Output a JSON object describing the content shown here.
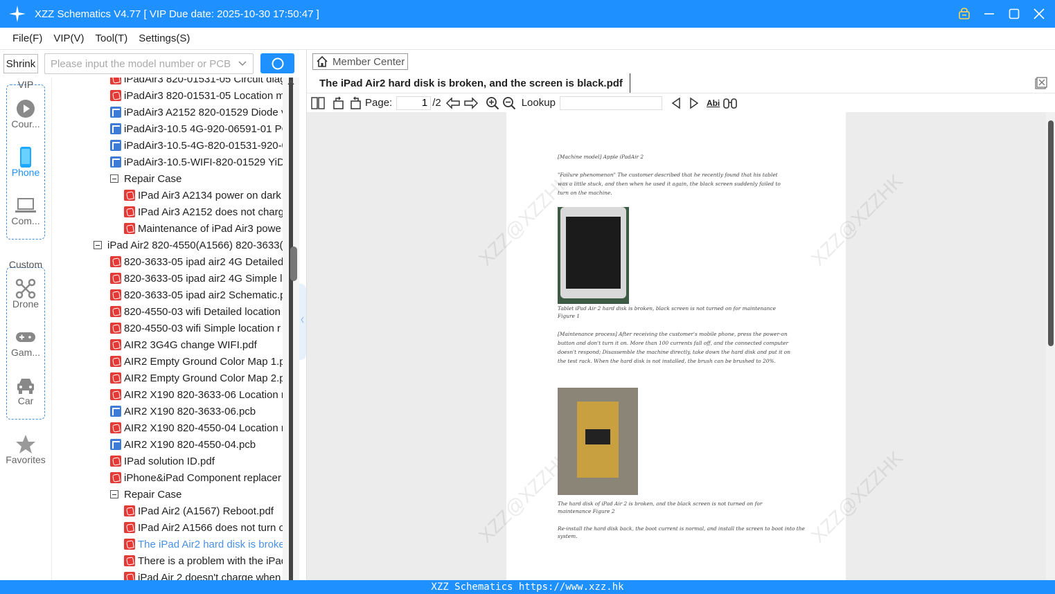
{
  "window": {
    "title": "XZZ Schematics V4.77 [ VIP Due date: 2025-10-30 17:50:47 ]"
  },
  "menu": [
    "File(F)",
    "VIP(V)",
    "Tool(T)",
    "Settings(S)"
  ],
  "search": {
    "shrink_label": "Shrink",
    "placeholder": "Please input the model number or PCB"
  },
  "rail": {
    "vip_label": "VIP",
    "custom_label": "Custom",
    "items": [
      "Cour...",
      "Phone",
      "Com...",
      "Drone",
      "Gam...",
      "Car",
      "Favorites"
    ]
  },
  "tree": [
    {
      "text": "iPadAir3 820-01531-05 Circuit diag",
      "kind": "pdf",
      "level": 1
    },
    {
      "text": "iPadAir3 820-01531-05 Location m",
      "kind": "pdf",
      "level": 1
    },
    {
      "text": "iPadAir3 A2152 820-01529 Diode v",
      "kind": "pcb",
      "level": 1
    },
    {
      "text": "iPadAir3-10.5 4G-920-06591-01 PC",
      "kind": "pcb",
      "level": 1
    },
    {
      "text": "iPadAir3-10.5-4G-820-01531-920-0",
      "kind": "pcb",
      "level": 1
    },
    {
      "text": "iPadAir3-10.5-WIFI-820-01529 YiDi",
      "kind": "pcb",
      "level": 1
    },
    {
      "text": "Repair Case",
      "kind": "folder",
      "level": 1
    },
    {
      "text": "IPad Air3 A2134 power on dark",
      "kind": "pdf",
      "level": 2
    },
    {
      "text": "IPad Air3 A2152 does not charg",
      "kind": "pdf",
      "level": 2
    },
    {
      "text": "Maintenance of iPad Air3 powe",
      "kind": "pdf",
      "level": 2
    },
    {
      "text": "iPad Air2 820-4550(A1566) 820-3633(",
      "kind": "folder",
      "level": 0
    },
    {
      "text": "820-3633-05 ipad air2 4G Detailed",
      "kind": "pdf",
      "level": 1
    },
    {
      "text": "820-3633-05 ipad air2 4G Simple lo",
      "kind": "pdf",
      "level": 1
    },
    {
      "text": "820-3633-05 ipad air2 Schematic.p",
      "kind": "pdf",
      "level": 1
    },
    {
      "text": "820-4550-03 wifi Detailed location",
      "kind": "pdf",
      "level": 1
    },
    {
      "text": "820-4550-03 wifi Simple location r",
      "kind": "pdf",
      "level": 1
    },
    {
      "text": "AIR2 3G4G change WIFI.pdf",
      "kind": "pdf",
      "level": 1
    },
    {
      "text": "AIR2 Empty Ground Color Map 1.p",
      "kind": "pdf",
      "level": 1
    },
    {
      "text": "AIR2 Empty Ground Color Map 2.p",
      "kind": "pdf",
      "level": 1
    },
    {
      "text": "AIR2 X190 820-3633-06 Location m",
      "kind": "pdf",
      "level": 1
    },
    {
      "text": "AIR2 X190 820-3633-06.pcb",
      "kind": "pcb",
      "level": 1
    },
    {
      "text": "AIR2 X190 820-4550-04 Location m",
      "kind": "pdf",
      "level": 1
    },
    {
      "text": "AIR2 X190 820-4550-04.pcb",
      "kind": "pcb",
      "level": 1
    },
    {
      "text": "IPad solution ID.pdf",
      "kind": "pdf",
      "level": 1
    },
    {
      "text": "iPhone&iPad Component replacer",
      "kind": "pdf",
      "level": 1
    },
    {
      "text": "Repair Case",
      "kind": "folder",
      "level": 1
    },
    {
      "text": "IPad Air2 (A1567) Reboot.pdf",
      "kind": "pdf",
      "level": 2
    },
    {
      "text": "IPad Air2 A1566 does not turn o",
      "kind": "pdf",
      "level": 2
    },
    {
      "text": "The iPad Air2 hard disk is broke",
      "kind": "pdf",
      "level": 2,
      "selected": true
    },
    {
      "text": "There is a problem with the iPad",
      "kind": "pdf",
      "level": 2
    },
    {
      "text": "iPad Air 2 doesn't charge when",
      "kind": "pdf",
      "level": 2
    }
  ],
  "right": {
    "member_center": "Member Center",
    "doc_title": "The iPad Air2 hard disk is broken, and the screen is black.pdf",
    "page_label": "Page:",
    "page_current": "1",
    "page_total": "/2",
    "lookup_label": "Lookup",
    "abi_label": "Abi"
  },
  "pdf_content": {
    "model": "[Machine model] Apple iPadAir 2",
    "failure": "\"Failure phenomenon\" The customer described that he recently found that his tablet was a little stuck, and then when he used it again, the black screen suddenly failed to turn on the machine.",
    "fig1": "Tablet iPad Air 2 hard disk is broken, black screen is not turned on for maintenance Figure 1",
    "process": "[Maintenance process] After receiving the customer's mobile phone, press the power-on button and don't turn it on. More than 100 currents fall off, and the connected computer doesn't respond; Disassemble the machine directly, take down the hard disk and put it on the test rack. When the hard disk is not installed, the brush can be brushed to 20%.",
    "fig2": "The hard disk of iPad Air 2 is broken, and the black screen is not turned on for maintenance Figure 2",
    "reinstall": "Re-install the hard disk back, the boot current is normal, and install the screen to boot into the system.",
    "watermark": "XZZ@XZZHK"
  },
  "footer": "XZZ Schematics https://www.xzz.hk"
}
